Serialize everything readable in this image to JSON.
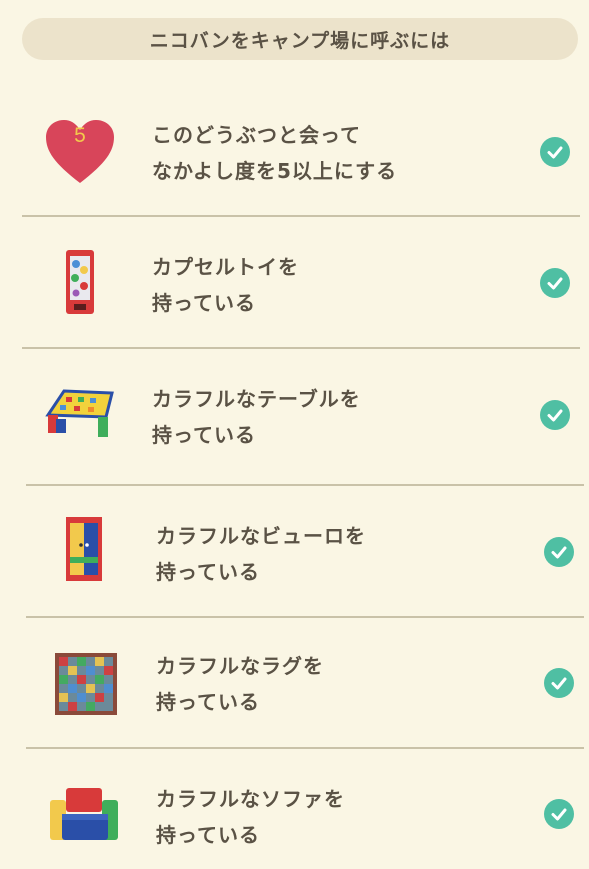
{
  "header": {
    "title": "ニコバンをキャンプ場に呼ぶには"
  },
  "conditions": [
    {
      "line1": "このどうぶつと会って",
      "line2": "なかよし度を5以上にする",
      "icon": "heart-icon",
      "badge": "5",
      "done": true
    },
    {
      "line1": "カプセルトイを",
      "line2": "持っている",
      "icon": "capsule-toy-icon",
      "done": true
    },
    {
      "line1": "カラフルなテーブルを",
      "line2": "持っている",
      "icon": "colorful-table-icon",
      "done": true
    },
    {
      "line1": "カラフルなビューロを",
      "line2": "持っている",
      "icon": "colorful-bureau-icon",
      "done": true
    },
    {
      "line1": "カラフルなラグを",
      "line2": "持っている",
      "icon": "colorful-rug-icon",
      "done": true
    },
    {
      "line1": "カラフルなソファを",
      "line2": "持っている",
      "icon": "colorful-sofa-icon",
      "done": true
    }
  ],
  "colors": {
    "background": "#faf6e4",
    "header_bg": "#ece3cb",
    "text": "#5a5245",
    "check": "#4fbfa3",
    "heart": "#d8455a",
    "heart_number": "#f2c94c"
  }
}
